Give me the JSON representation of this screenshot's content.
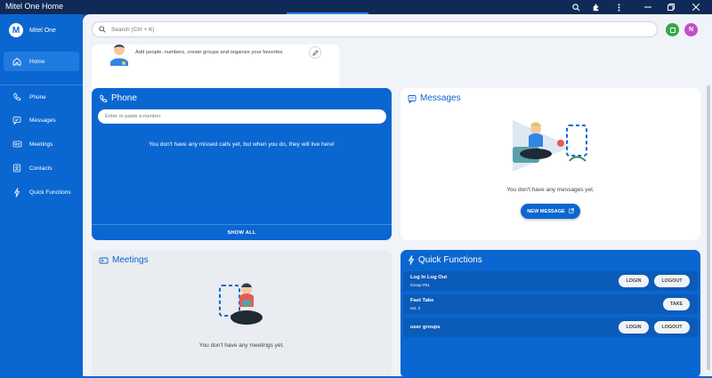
{
  "window": {
    "title": "Mitel One Home",
    "controls": [
      "zoom-icon",
      "extension-icon",
      "more-icon",
      "minimize-icon",
      "restore-icon",
      "close-icon"
    ]
  },
  "brand": {
    "logo_letter": "M",
    "name": "Mitel One"
  },
  "sidebar": {
    "items": [
      {
        "label": "Home",
        "icon": "home-icon",
        "active": true
      },
      {
        "label": "Phone",
        "icon": "phone-icon"
      },
      {
        "label": "Messages",
        "icon": "message-icon"
      },
      {
        "label": "Meetings",
        "icon": "meetings-icon"
      },
      {
        "label": "Contacts",
        "icon": "contacts-icon"
      },
      {
        "label": "Quick Functions",
        "icon": "lightning-icon"
      }
    ]
  },
  "search": {
    "placeholder": "Search (Ctrl + K)"
  },
  "user": {
    "initial": "N"
  },
  "contacts_card": {
    "hint": "Add people, numbers, create groups and organize your favorites."
  },
  "phone_card": {
    "title": "Phone",
    "input_placeholder": "Enter or paste a number",
    "empty_text": "You don't have any missed calls yet, but when you do, they will live here!",
    "show_all": "SHOW ALL"
  },
  "messages_card": {
    "title": "Messages",
    "empty_text": "You don't have any messages yet.",
    "new_message": "NEW MESSAGE"
  },
  "meetings_card": {
    "title": "Meetings",
    "empty_text": "You don't have any meetings yet."
  },
  "quick_functions": {
    "title": "Quick Functions",
    "rows": [
      {
        "name": "Log In Log Out",
        "sub": "Group #01",
        "buttons": [
          "LOGIN",
          "LOGOUT"
        ]
      },
      {
        "name": "Fast Take",
        "sub": "ext. 2",
        "buttons": [
          "TAKE"
        ]
      },
      {
        "name": "user groups",
        "sub": "",
        "buttons": [
          "LOGIN",
          "LOGOUT"
        ]
      }
    ]
  },
  "colors": {
    "primary": "#0a66d1",
    "sidebar": "#0a66d1",
    "titlebar": "#0f2a56",
    "status_green": "#37a74a",
    "avatar": "#c152c6"
  }
}
